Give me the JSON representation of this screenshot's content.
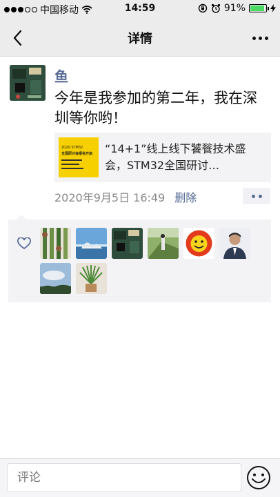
{
  "status_bar": {
    "carrier": "中国移动",
    "time": "14:59",
    "battery": "91%",
    "battery_level": 0.91
  },
  "nav": {
    "title": "详情",
    "back_icon": "chevron-left-icon",
    "more_icon": "more-dots-icon"
  },
  "post": {
    "username": "鱼",
    "text": "今年是我参加的第二年，我在深圳等你哟！",
    "share": {
      "title": "“14+1”线上线下饕餮技术盛会，STM32全国研讨…",
      "thumb_lines": [
        "2020 STM32",
        "全国研讨会报名开启"
      ]
    },
    "time": "2020年9月5日 16:49",
    "delete_label": "删除"
  },
  "likes": {
    "icon": "heart-icon",
    "count_shown": 8
  },
  "comment_bar": {
    "placeholder": "评论",
    "emoji_icon": "smiley-icon"
  },
  "colors": {
    "link": "#576b95",
    "bar_bg": "#ececec",
    "battery": "#4cd964",
    "card_thumb": "#f6d000"
  }
}
